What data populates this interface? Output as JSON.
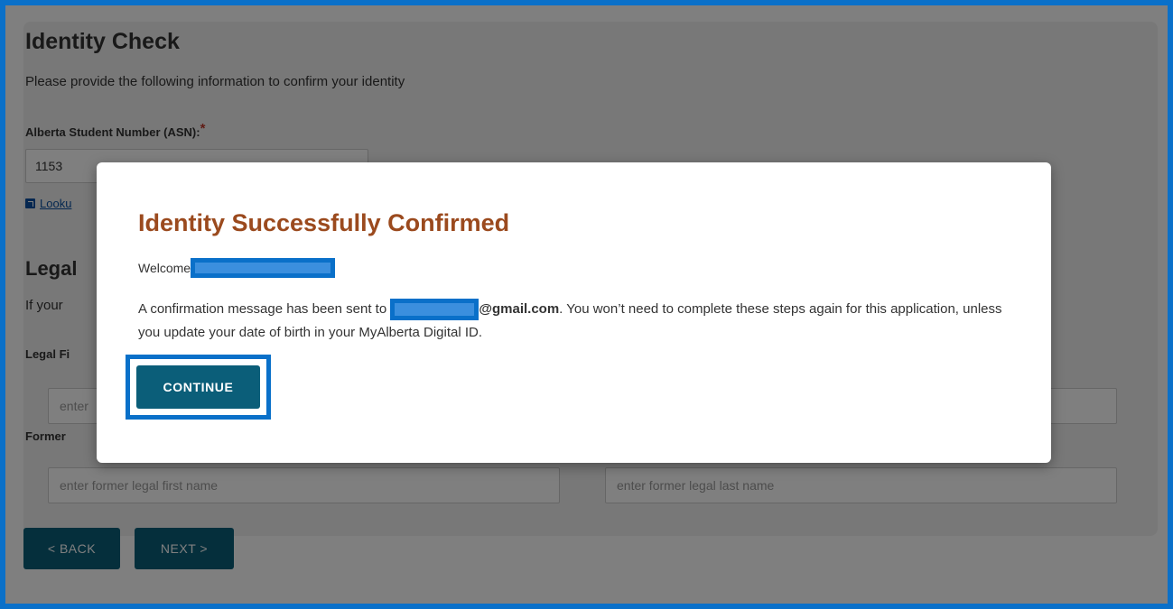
{
  "form": {
    "title": "Identity Check",
    "subtitle": "Please provide the following information to confirm your identity",
    "asn_label": "Alberta Student Number (ASN):",
    "asn_required": "*",
    "asn_value": "1153",
    "lookup_link": "Looku",
    "legal_heading": "Legal",
    "legal_desc": "If your",
    "legal_first_label": "Legal Fi",
    "legal_first_placeholder": "enter",
    "former_label": "Former",
    "former_first_placeholder": "enter former legal first name",
    "former_last_placeholder": "enter former legal last name"
  },
  "nav": {
    "back_label": "< BACK",
    "next_label": "NEXT >"
  },
  "modal": {
    "title": "Identity Successfully Confirmed",
    "welcome": "Welcome",
    "message_prefix": "A confirmation message has been sent to",
    "email_domain": "@gmail.com",
    "message_suffix": ". You won’t need to complete these steps again for this application, unless you update your date of birth in your MyAlberta Digital ID.",
    "continue_label": "CONTINUE"
  },
  "colors": {
    "highlight": "#0a70c9",
    "primary_button": "#0b5e79",
    "modal_title": "#9b4a1e"
  }
}
